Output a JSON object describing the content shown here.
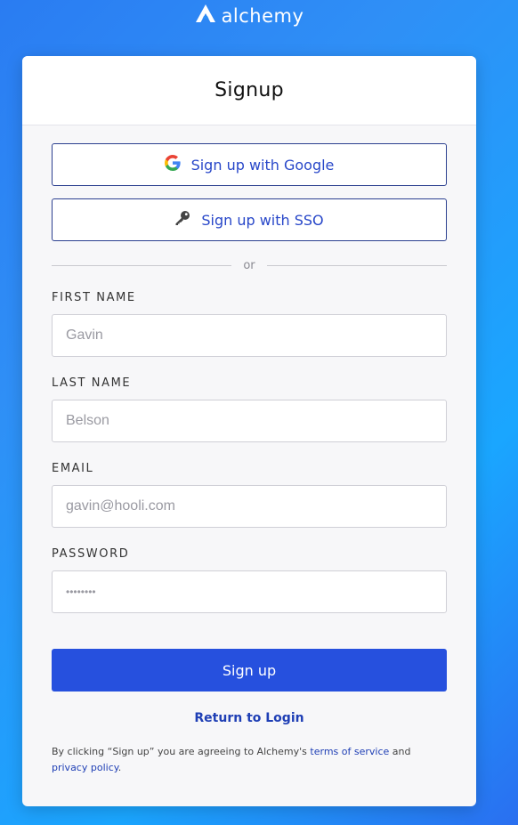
{
  "brand": {
    "name": "alchemy"
  },
  "card": {
    "title": "Signup"
  },
  "oauth": {
    "google_label": "Sign up with Google",
    "sso_label": "Sign up with SSO"
  },
  "divider": {
    "text": "or"
  },
  "fields": {
    "first_name": {
      "label": "FIRST NAME",
      "placeholder": "Gavin"
    },
    "last_name": {
      "label": "LAST NAME",
      "placeholder": "Belson"
    },
    "email": {
      "label": "EMAIL",
      "placeholder": "gavin@hooli.com"
    },
    "password": {
      "label": "PASSWORD",
      "placeholder": "••••••••"
    }
  },
  "actions": {
    "signup_label": "Sign up",
    "return_login_label": "Return to Login"
  },
  "terms": {
    "prefix": "By clicking “Sign up” you are agreeing to Alchemy's ",
    "tos_link": "terms of service",
    "middle": " and ",
    "privacy_link": "privacy policy",
    "suffix": "."
  },
  "colors": {
    "primary": "#2650de",
    "link": "#1f3fb5",
    "background_gradient_start": "#2a7cf2",
    "background_gradient_end": "#1aa6ff"
  },
  "icons": {
    "brand_logo": "alchemy-logo-icon",
    "google": "google-icon",
    "sso": "key-icon"
  }
}
